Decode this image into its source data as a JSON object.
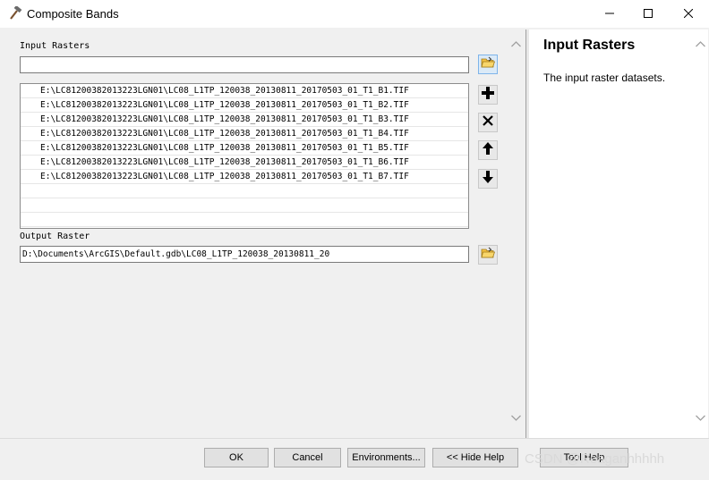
{
  "window": {
    "title": "Composite Bands"
  },
  "form": {
    "input_rasters_label": "Input Rasters",
    "input_rasters_value": "",
    "rasters": [
      "E:\\LC81200382013223LGN01\\LC08_L1TP_120038_20130811_20170503_01_T1_B1.TIF",
      "E:\\LC81200382013223LGN01\\LC08_L1TP_120038_20130811_20170503_01_T1_B2.TIF",
      "E:\\LC81200382013223LGN01\\LC08_L1TP_120038_20130811_20170503_01_T1_B3.TIF",
      "E:\\LC81200382013223LGN01\\LC08_L1TP_120038_20130811_20170503_01_T1_B4.TIF",
      "E:\\LC81200382013223LGN01\\LC08_L1TP_120038_20130811_20170503_01_T1_B5.TIF",
      "E:\\LC81200382013223LGN01\\LC08_L1TP_120038_20130811_20170503_01_T1_B6.TIF",
      "E:\\LC81200382013223LGN01\\LC08_L1TP_120038_20130811_20170503_01_T1_B7.TIF"
    ],
    "output_raster_label": "Output Raster",
    "output_raster_value": "D:\\Documents\\ArcGIS\\Default.gdb\\LC08_L1TP_120038_20130811_20"
  },
  "help": {
    "title": "Input Rasters",
    "text": "The input raster datasets."
  },
  "buttons": {
    "ok": "OK",
    "cancel": "Cancel",
    "environments": "Environments...",
    "hide_help": "<< Hide Help",
    "tool_help": "Tool Help"
  },
  "watermark": "CSDN @Reaganhhhhh",
  "colors": {
    "folder_button_bg": "#dbeaf7",
    "folder_yellow": "#f5c242"
  }
}
